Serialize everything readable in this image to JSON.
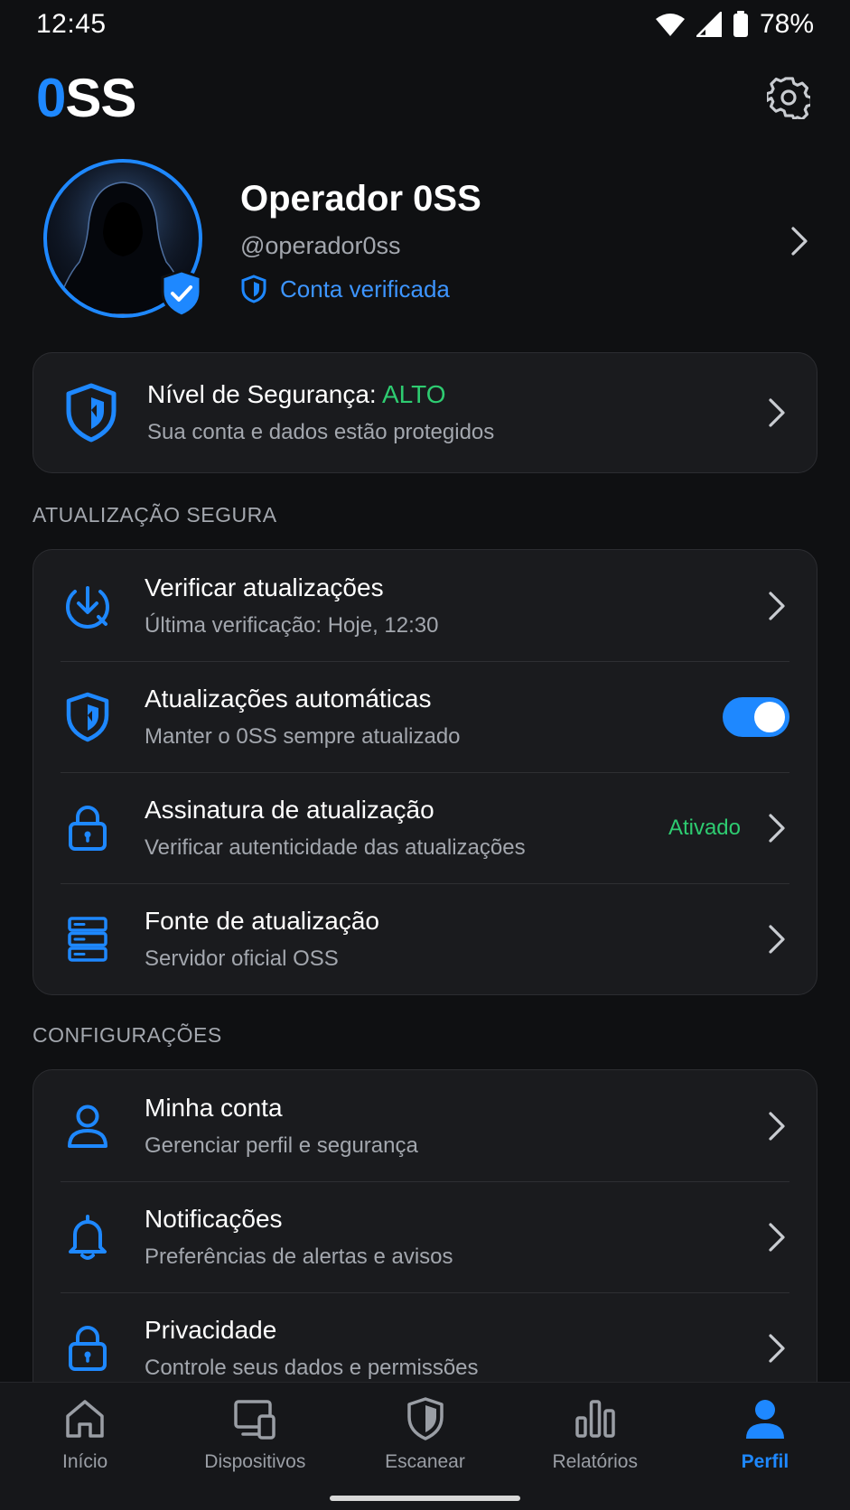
{
  "status_bar": {
    "time": "12:45",
    "battery": "78%"
  },
  "header": {
    "logo_accent": "0",
    "logo_rest": "SS"
  },
  "profile": {
    "name": "Operador 0SS",
    "handle": "@operador0ss",
    "verified_label": "Conta verificada"
  },
  "security": {
    "title_prefix": "Nível de Segurança:",
    "level": "ALTO",
    "subtitle": "Sua conta e dados estão protegidos"
  },
  "sections": {
    "update_title": "ATUALIZAÇÃO SEGURA",
    "settings_title": "CONFIGURAÇÕES"
  },
  "update_items": [
    {
      "title": "Verificar atualizações",
      "subtitle": "Última verificação: Hoje, 12:30"
    },
    {
      "title": "Atualizações automáticas",
      "subtitle": "Manter o 0SS sempre atualizado",
      "toggle_on": true
    },
    {
      "title": "Assinatura de atualização",
      "subtitle": "Verificar autenticidade das atualizações",
      "status": "Ativado"
    },
    {
      "title": "Fonte de atualização",
      "subtitle": "Servidor oficial OSS"
    }
  ],
  "settings_items": [
    {
      "title": "Minha conta",
      "subtitle": "Gerenciar perfil e segurança"
    },
    {
      "title": "Notificações",
      "subtitle": "Preferências de alertas e avisos"
    },
    {
      "title": "Privacidade",
      "subtitle": "Controle seus dados e permissões"
    }
  ],
  "nav": [
    {
      "label": "Início",
      "icon": "home-icon"
    },
    {
      "label": "Dispositivos",
      "icon": "devices-icon"
    },
    {
      "label": "Escanear",
      "icon": "shield-icon"
    },
    {
      "label": "Relatórios",
      "icon": "bar-chart-icon"
    },
    {
      "label": "Perfil",
      "icon": "person-icon",
      "active": true
    }
  ],
  "colors": {
    "accent": "#1e88ff",
    "success": "#2ecc71",
    "background": "#0f1012",
    "card": "#1a1b1e"
  }
}
